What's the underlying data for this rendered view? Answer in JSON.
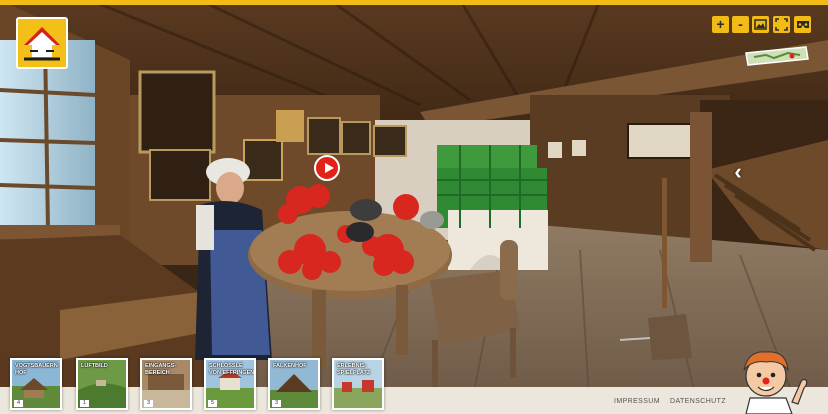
{
  "controls": [
    {
      "name": "zoom-in-button",
      "label": "+"
    },
    {
      "name": "zoom-out-button",
      "label": "-"
    },
    {
      "name": "gallery-button",
      "icon": "image-icon"
    },
    {
      "name": "fullscreen-button",
      "icon": "fullscreen-icon"
    },
    {
      "name": "vr-button",
      "icon": "vr-goggles-icon"
    }
  ],
  "nav": {
    "next_arrow": "‹"
  },
  "thumbnails": [
    {
      "label": "VOGTSBAUERN-HOF",
      "num": "4"
    },
    {
      "label": "LUFTBILD",
      "num": "1"
    },
    {
      "label": "EINGANGS-BEREICH",
      "num": "3"
    },
    {
      "label": "SCHLÖSSLE VON EFFRINGEN",
      "num": "5"
    },
    {
      "label": "FALKENHOF",
      "num": "3"
    },
    {
      "label": "ERLEBNIS-SPIELPLATZ",
      "num": ""
    }
  ],
  "footer": {
    "impressum": "IMPRESSUM",
    "datenschutz": "DATENSCHUTZ"
  },
  "colors": {
    "accent": "#f2bb16",
    "hotspot": "#e2231a",
    "footer_bg": "#ece7dd"
  }
}
